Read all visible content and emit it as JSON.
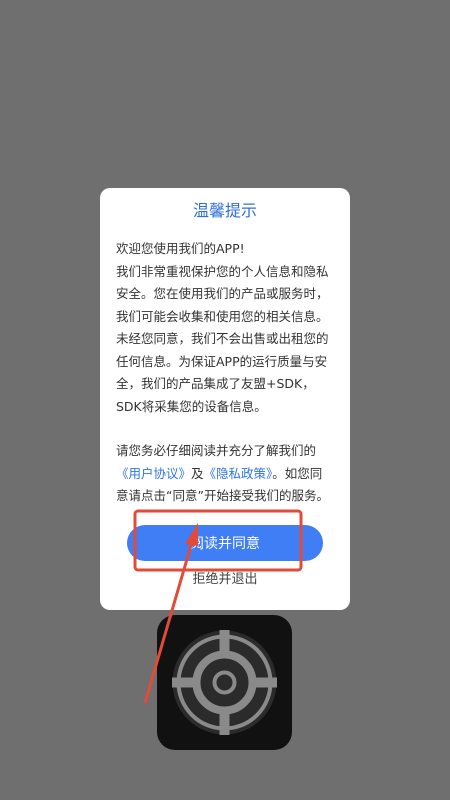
{
  "dialog": {
    "title": "温馨提示",
    "paragraphs": [
      "欢迎您使用我们的APP!",
      "我们非常重视保护您的个人信息和隐私安全。您在使用我们的产品或服务时，我们可能会收集和使用您的相关信息。未经您同意，我们不会出售或出租您的任何信息。为保证APP的运行质量与安全，我们的产品集成了友盟+SDK，SDK将采集您的设备信息。"
    ],
    "notice": {
      "before": "请您务必仔细阅读并充分了解我们的",
      "link_user_agreement": "《用户协议》",
      "and": "及",
      "link_privacy_policy": "《隐私政策》",
      "after": "。如您同意请点击“同意”开始接受我们的服务。"
    },
    "agree_button": "阅读并同意",
    "exit_link": "拒绝并退出"
  },
  "app_icon": {
    "icon_name": "target-crosshair-icon"
  },
  "colors": {
    "title": "#2f6fd8",
    "primary_button": "#3f7ef5",
    "link": "#2f74ea",
    "annotation": "#e14b38",
    "background_overlay": "#6f6f6f"
  }
}
